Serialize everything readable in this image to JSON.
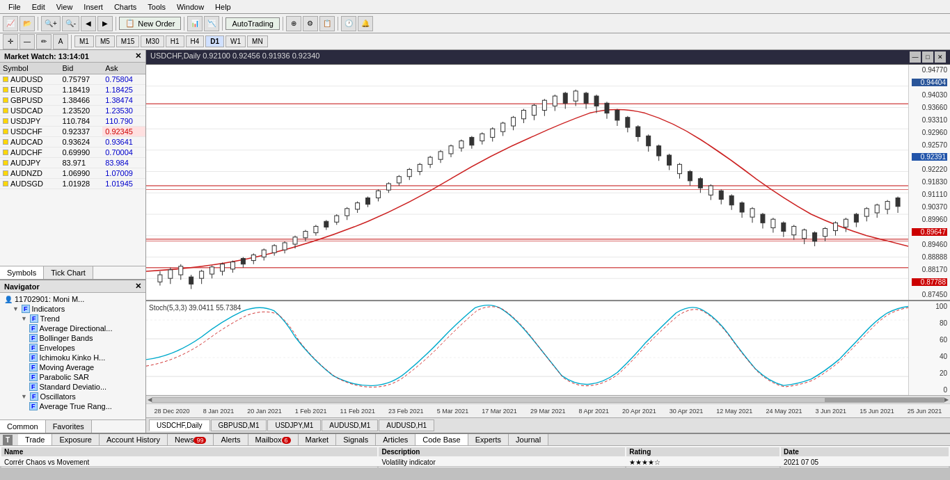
{
  "menubar": {
    "items": [
      "File",
      "Edit",
      "View",
      "Insert",
      "Charts",
      "Tools",
      "Window",
      "Help"
    ]
  },
  "toolbar": {
    "new_order": "New Order",
    "autotrading": "AutoTrading",
    "timeframes": [
      "M1",
      "M5",
      "M15",
      "M30",
      "H1",
      "H4",
      "D1",
      "W1",
      "MN"
    ]
  },
  "market_watch": {
    "title": "Market Watch: 13:14:01",
    "columns": [
      "Symbol",
      "Bid",
      "Ask"
    ],
    "symbols": [
      {
        "name": "AUDUSD",
        "bid": "0.75797",
        "ask": "0.75804",
        "highlight_ask": false
      },
      {
        "name": "EURUSD",
        "bid": "1.18419",
        "ask": "1.18425",
        "highlight_ask": false
      },
      {
        "name": "GBPUSD",
        "bid": "1.38466",
        "ask": "1.38474",
        "highlight_ask": false
      },
      {
        "name": "USDCAD",
        "bid": "1.23520",
        "ask": "1.23530",
        "highlight_ask": false
      },
      {
        "name": "USDJPY",
        "bid": "110.784",
        "ask": "110.790",
        "highlight_ask": false
      },
      {
        "name": "USDCHF",
        "bid": "0.92337",
        "ask": "0.92345",
        "highlight_ask": true
      },
      {
        "name": "AUDCAD",
        "bid": "0.93624",
        "ask": "0.93641",
        "highlight_ask": false
      },
      {
        "name": "AUDCHF",
        "bid": "0.69990",
        "ask": "0.70004",
        "highlight_ask": false
      },
      {
        "name": "AUDJPY",
        "bid": "83.971",
        "ask": "83.984",
        "highlight_ask": false
      },
      {
        "name": "AUDNZD",
        "bid": "1.06990",
        "ask": "1.07009",
        "highlight_ask": false
      },
      {
        "name": "AUDSGD",
        "bid": "1.01928",
        "ask": "1.01945",
        "highlight_ask": false
      }
    ],
    "tabs": [
      "Symbols",
      "Tick Chart"
    ]
  },
  "navigator": {
    "title": "Navigator",
    "account": "11702901: Moni M...",
    "indicators": {
      "label": "Indicators",
      "trend": {
        "label": "Trend",
        "items": [
          "Average Directional...",
          "Bollinger Bands",
          "Envelopes",
          "Ichimoku Kinko H...",
          "Moving Average",
          "Parabolic SAR",
          "Standard Deviatio..."
        ]
      },
      "oscillators": {
        "label": "Oscillators",
        "items": [
          "Average True Rang..."
        ]
      }
    },
    "tabs": [
      "Common",
      "Favorites"
    ]
  },
  "chart": {
    "header": "USDCHF,Daily  0.92100  0.92456  0.91936  0.92340",
    "indicator_label": "Stoch(5,3,3)  39.0411  55.7384",
    "price_levels": [
      "0.94770",
      "0.94404",
      "0.94030",
      "0.93660",
      "0.93310",
      "0.92960",
      "0.92570",
      "0.92391",
      "0.92220",
      "0.91830",
      "0.91110",
      "0.90370",
      "0.89960",
      "0.89647",
      "0.89460",
      "0.88888",
      "0.88170",
      "0.87788",
      "0.87450"
    ],
    "indicator_price_levels": [
      "100",
      "80",
      "60",
      "40",
      "20",
      "0"
    ],
    "time_labels": [
      "28 Dec 2020",
      "8 Jan 2021",
      "20 Jan 2021",
      "1 Feb 2021",
      "11 Feb 2021",
      "23 Feb 2021",
      "5 Mar 2021",
      "17 Mar 2021",
      "29 Mar 2021",
      "8 Apr 2021",
      "20 Apr 2021",
      "30 Apr 2021",
      "12 May 2021",
      "24 May 2021",
      "3 Jun 2021",
      "15 Jun 2021",
      "25 Jun 2021"
    ],
    "tabs": [
      "USDCHF,Daily",
      "GBPUSD,M1",
      "USDJPY,M1",
      "AUDUSD,M1",
      "AUDUSD,H1"
    ],
    "active_tab": "USDCHF,Daily"
  },
  "terminal": {
    "columns": [
      "Name",
      "Description",
      "Rating",
      "Date"
    ],
    "tabs": [
      "Trade",
      "Exposure",
      "Account History",
      "News",
      "Alerts",
      "Mailbox",
      "Market",
      "Signals",
      "Articles",
      "Code Base",
      "Experts",
      "Journal"
    ],
    "active_tab": "Code Base",
    "news_badge": "99",
    "mailbox_badge": "6",
    "row": {
      "name": "Corrér Chaos vs Movement",
      "description": "Volatility indicator",
      "rating": "★★★★☆",
      "date": "2021 07 05"
    }
  },
  "colors": {
    "accent_blue": "#2a5599",
    "accent_red": "#cc0000",
    "chart_bg": "#ffffff",
    "candle_up": "#000000",
    "candle_down": "#000000",
    "ma_line": "#cc2222",
    "stoch_main": "#00aacc",
    "stoch_signal": "#cc2222",
    "horizontal_line_color": "#cc3333"
  }
}
